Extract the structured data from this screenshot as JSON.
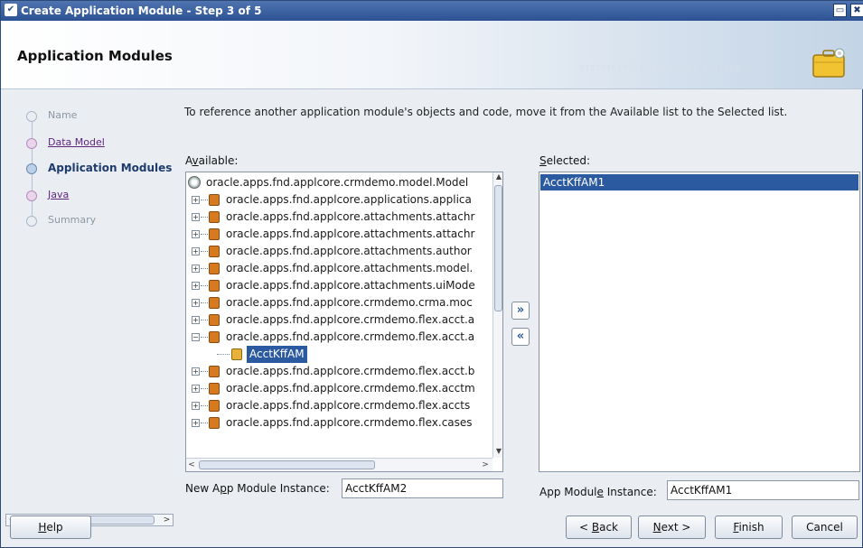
{
  "window": {
    "title": "Create Application Module - Step 3 of 5",
    "menu_glyph": "✔",
    "restore_glyph": "▭",
    "close_glyph": "✖"
  },
  "banner": {
    "heading": "Application Modules",
    "binary_text": "0101010101010101010101 0101010"
  },
  "steps": [
    {
      "label": "Name",
      "state": "disabled"
    },
    {
      "label": "Data Model",
      "state": "link"
    },
    {
      "label": "Application Modules",
      "state": "current"
    },
    {
      "label": "Java",
      "state": "link"
    },
    {
      "label": "Summary",
      "state": "disabled"
    }
  ],
  "instruction": "To reference another application module's objects and code, move it from the Available list to the Selected list.",
  "available": {
    "label": "Available:",
    "root": "oracle.apps.fnd.applcore.crmdemo.model.Model",
    "packages": [
      {
        "text": "oracle.apps.fnd.applcore.applications.applica",
        "expanded": false
      },
      {
        "text": "oracle.apps.fnd.applcore.attachments.attachr",
        "expanded": false
      },
      {
        "text": "oracle.apps.fnd.applcore.attachments.attachr",
        "expanded": false
      },
      {
        "text": "oracle.apps.fnd.applcore.attachments.author",
        "expanded": false
      },
      {
        "text": "oracle.apps.fnd.applcore.attachments.model.",
        "expanded": false
      },
      {
        "text": "oracle.apps.fnd.applcore.attachments.uiMode",
        "expanded": false
      },
      {
        "text": "oracle.apps.fnd.applcore.crmdemo.crma.moc",
        "expanded": false
      },
      {
        "text": "oracle.apps.fnd.applcore.crmdemo.flex.acct.a",
        "expanded": false
      },
      {
        "text": "oracle.apps.fnd.applcore.crmdemo.flex.acct.a",
        "expanded": true
      },
      {
        "text": "oracle.apps.fnd.applcore.crmdemo.flex.acct.b",
        "expanded": false
      },
      {
        "text": "oracle.apps.fnd.applcore.crmdemo.flex.acctm",
        "expanded": false
      },
      {
        "text": "oracle.apps.fnd.applcore.crmdemo.flex.accts",
        "expanded": false
      },
      {
        "text": "oracle.apps.fnd.applcore.crmdemo.flex.cases",
        "expanded": false
      }
    ],
    "child_selected": "AcctKffAM",
    "expand_glyph": "+",
    "collapse_glyph": "−"
  },
  "shuttle": {
    "add_glyph": "»",
    "remove_glyph": "«"
  },
  "selected": {
    "label": "Selected:",
    "items": [
      "AcctKffAM1"
    ]
  },
  "new_instance": {
    "label": "New App Module Instance:",
    "value": "AcctKffAM2"
  },
  "app_instance": {
    "label": "App Module Instance:",
    "value": "AcctKffAM1"
  },
  "buttons": {
    "help": "Help",
    "back": "< Back",
    "next": "Next >",
    "finish": "Finish",
    "cancel": "Cancel"
  },
  "scroll_glyphs": {
    "left": "<",
    "right": ">",
    "up": "▲",
    "down": "▼"
  }
}
